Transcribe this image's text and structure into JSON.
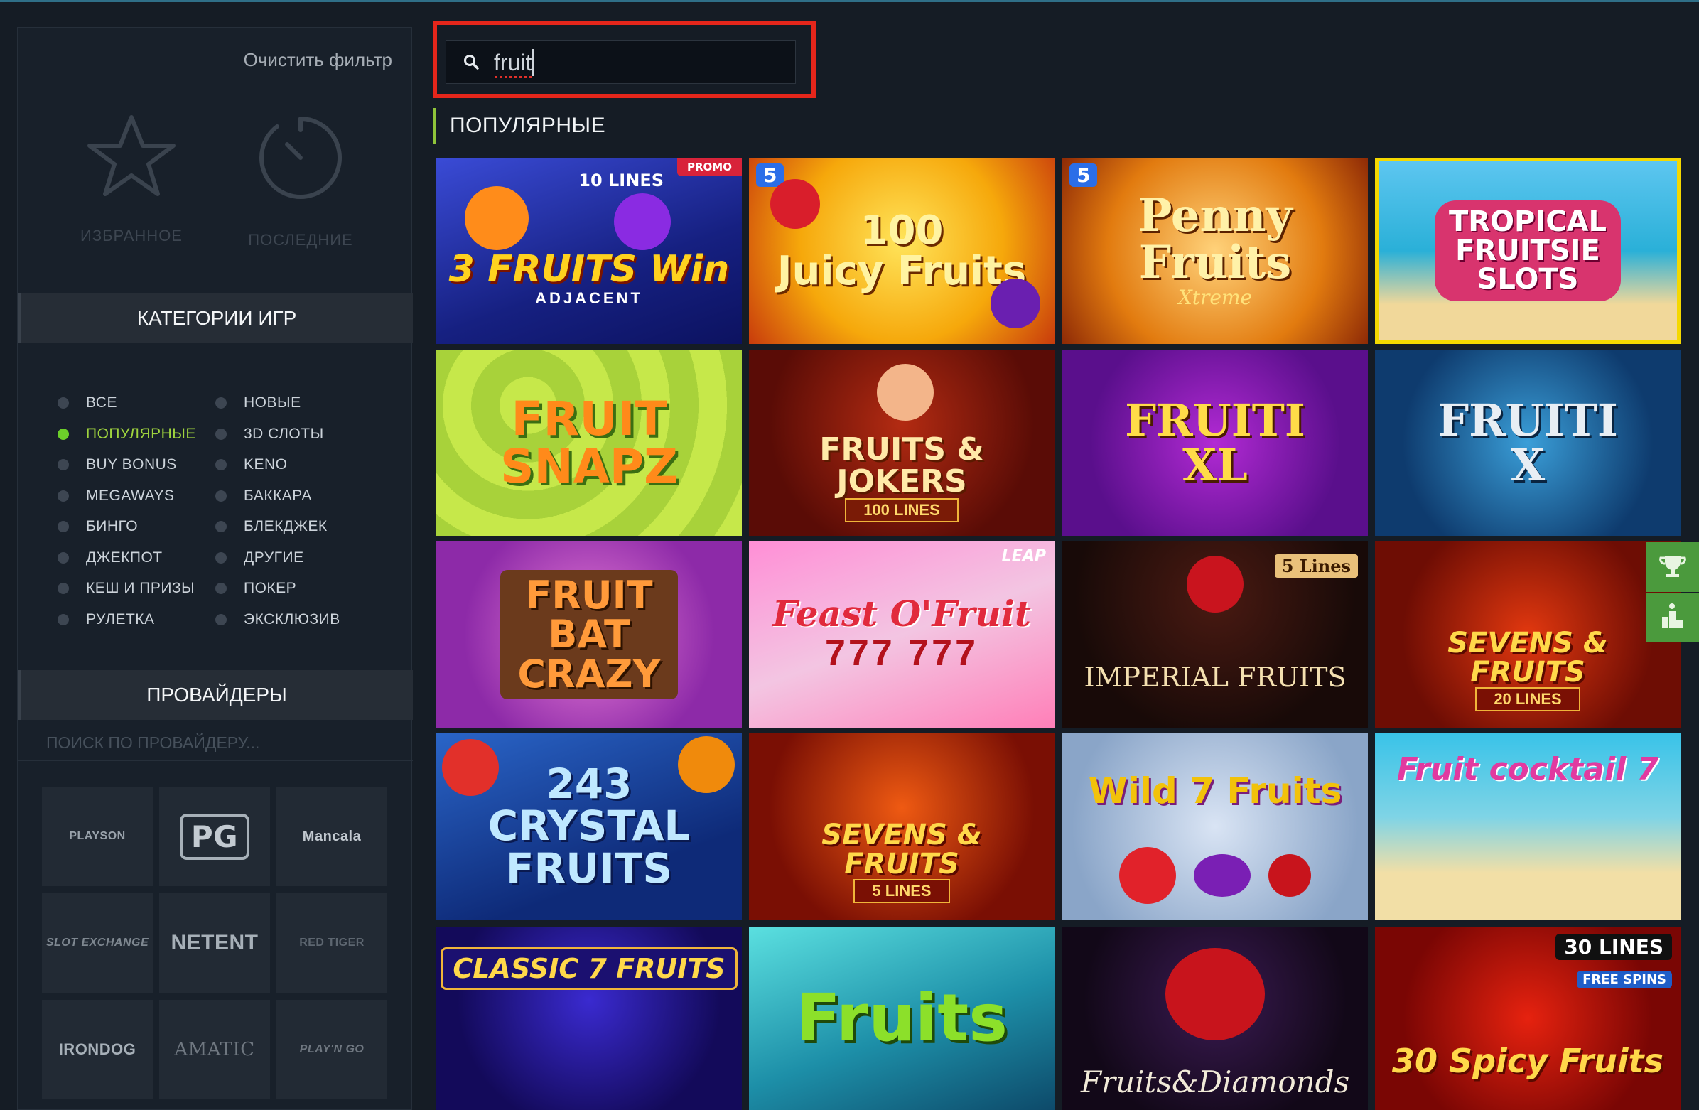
{
  "sidebar": {
    "clear_filter": "Очистить фильтр",
    "favorites_label": "ИЗБРАННОЕ",
    "recent_label": "ПОСЛЕДНИЕ",
    "categories_title": "КАТЕГОРИИ ИГР",
    "categories": [
      {
        "label": "ВСЕ",
        "active": false
      },
      {
        "label": "НОВЫЕ",
        "active": false
      },
      {
        "label": "ПОПУЛЯРНЫЕ",
        "active": true
      },
      {
        "label": "3D СЛОТЫ",
        "active": false
      },
      {
        "label": "BUY BONUS",
        "active": false
      },
      {
        "label": "KENO",
        "active": false
      },
      {
        "label": "MEGAWAYS",
        "active": false
      },
      {
        "label": "БАККАРА",
        "active": false
      },
      {
        "label": "БИНГО",
        "active": false
      },
      {
        "label": "БЛЕКДЖЕК",
        "active": false
      },
      {
        "label": "ДЖЕКПОТ",
        "active": false
      },
      {
        "label": "ДРУГИЕ",
        "active": false
      },
      {
        "label": "КЕШ И ПРИЗЫ",
        "active": false
      },
      {
        "label": "ПОКЕР",
        "active": false
      },
      {
        "label": "РУЛЕТКА",
        "active": false
      },
      {
        "label": "ЭКСКЛЮЗИВ",
        "active": false
      }
    ],
    "providers_title": "ПРОВАЙДЕРЫ",
    "provider_search_placeholder": "ПОИСК ПО ПРОВАЙДЕРУ...",
    "providers": [
      "PLAYSON",
      "PG",
      "Mancala",
      "SLOT EXCHANGE",
      "NETENT",
      "RED TIGER",
      "IRONDOG",
      "AMATIC",
      "PLAY'N GO"
    ]
  },
  "search": {
    "value": "fruit"
  },
  "section_title": "ПОПУЛЯРНЫЕ",
  "games": [
    {
      "title": "3 FRUITS Win",
      "sub": "ADJACENT",
      "badge": "PROMO",
      "corner": "10 LINES"
    },
    {
      "title": "100\nJuicy Fruits",
      "sub": "",
      "badge": "",
      "corner": "5"
    },
    {
      "title": "Penny\nFruits",
      "sub": "Xtreme",
      "badge": "",
      "corner": "5"
    },
    {
      "title": "TROPICAL\nFRUITSIE\nSLOTS",
      "sub": "",
      "badge": "",
      "corner": ""
    },
    {
      "title": "FRUIT\nSNAPZ",
      "sub": "",
      "badge": "",
      "corner": ""
    },
    {
      "title": "FRUITS & JOKERS",
      "sub": "100 LINES",
      "badge": "",
      "corner": ""
    },
    {
      "title": "FRUITI\nXL",
      "sub": "",
      "badge": "",
      "corner": ""
    },
    {
      "title": "FRUITI\nX",
      "sub": "",
      "badge": "",
      "corner": ""
    },
    {
      "title": "FRUIT\nBAT\nCRAZY",
      "sub": "",
      "badge": "",
      "corner": ""
    },
    {
      "title": "Feast O'Fruit",
      "sub": "777  777",
      "badge": "",
      "corner": "LEAP"
    },
    {
      "title": "IMPERIAL FRUITS",
      "sub": "",
      "badge": "",
      "corner": "5 Lines"
    },
    {
      "title": "SEVENS & FRUITS",
      "sub": "20 LINES",
      "badge": "",
      "corner": ""
    },
    {
      "title": "243\nCRYSTAL\nFRUITS",
      "sub": "",
      "badge": "",
      "corner": ""
    },
    {
      "title": "SEVENS & FRUITS",
      "sub": "5 LINES",
      "badge": "",
      "corner": ""
    },
    {
      "title": "Wild 7 Fruits",
      "sub": "",
      "badge": "",
      "corner": ""
    },
    {
      "title": "Fruit cocktail 7",
      "sub": "",
      "badge": "",
      "corner": ""
    },
    {
      "title": "CLASSIC 7 FRUITS",
      "sub": "",
      "badge": "",
      "corner": ""
    },
    {
      "title": "Fruits",
      "sub": "",
      "badge": "",
      "corner": ""
    },
    {
      "title": "Fruits&Diamonds",
      "sub": "",
      "badge": "",
      "corner": ""
    },
    {
      "title": "30 Spicy Fruits",
      "sub": "",
      "badge": "FREE SPINS",
      "corner": "30 LINES"
    }
  ]
}
